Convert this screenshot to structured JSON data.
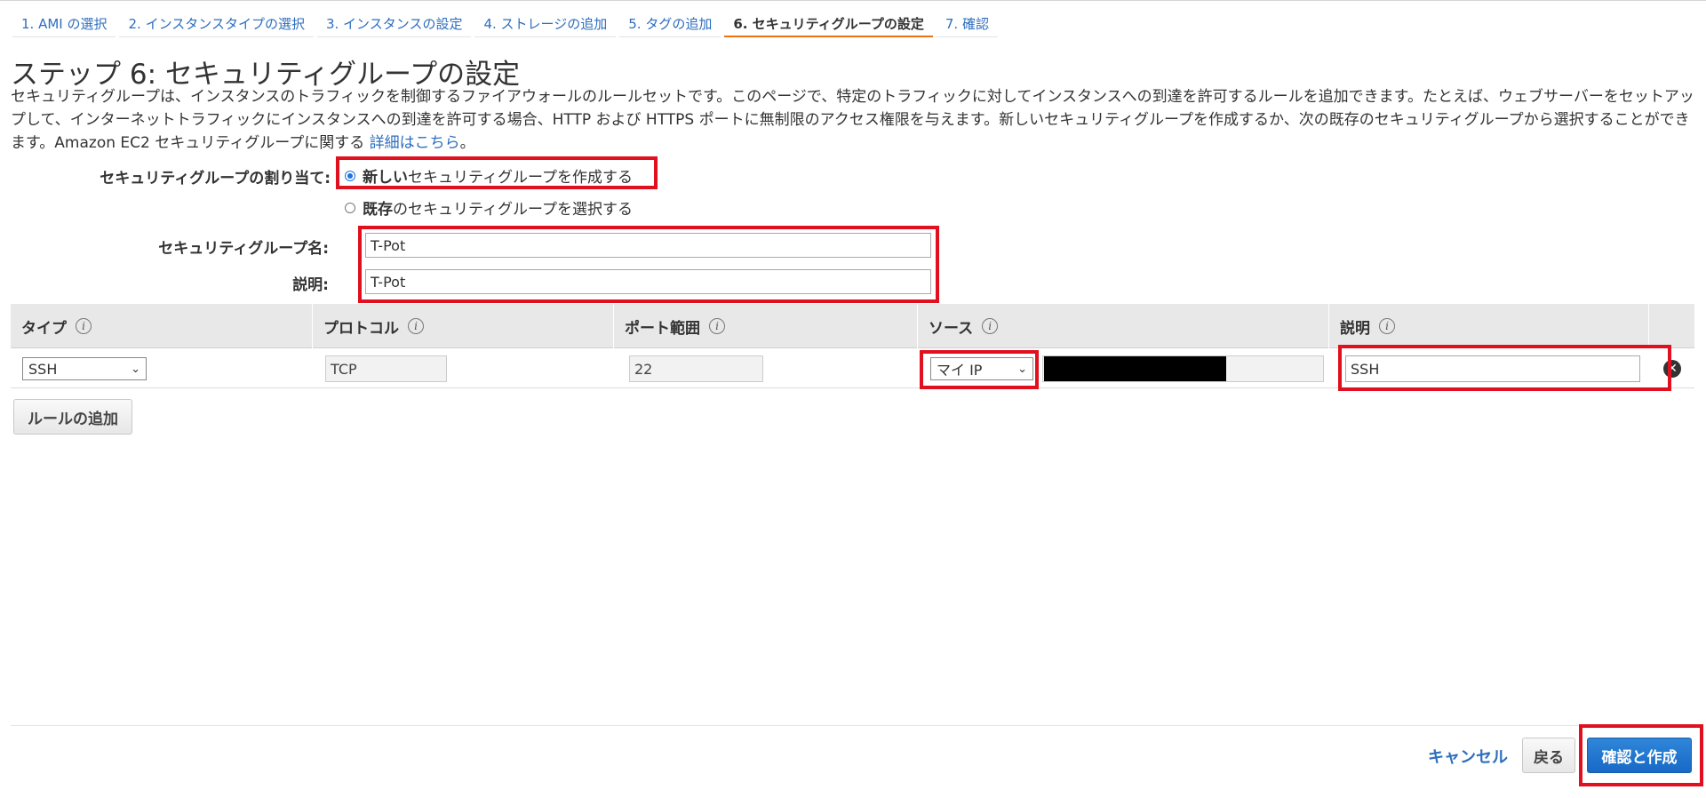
{
  "steps": [
    {
      "label": "1. AMI の選択"
    },
    {
      "label": "2. インスタンスタイプの選択"
    },
    {
      "label": "3. インスタンスの設定"
    },
    {
      "label": "4. ストレージの追加"
    },
    {
      "label": "5. タグの追加"
    },
    {
      "label": "6. セキュリティグループの設定",
      "active": true
    },
    {
      "label": "7. 確認"
    }
  ],
  "page": {
    "title": "ステップ 6: セキュリティグループの設定",
    "description": "セキュリティグループは、インスタンスのトラフィックを制御するファイアウォールのルールセットです。このページで、特定のトラフィックに対してインスタンスへの到達を許可するルールを追加できます。たとえば、ウェブサーバーをセットアップして、インターネットトラフィックにインスタンスへの到達を許可する場合、HTTP および HTTPS ポートに無制限のアクセス権限を与えます。新しいセキュリティグループを作成するか、次の既存のセキュリティグループから選択することができます。Amazon EC2 セキュリティグループに関する ",
    "learn_more": "詳細はこちら",
    "desc_end": "。"
  },
  "assign": {
    "label": "セキュリティグループの割り当て:",
    "option_new_bold": "新しい",
    "option_new_rest": "セキュリティグループを作成する",
    "option_existing_bold": "既存",
    "option_existing_rest": "のセキュリティグループを選択する",
    "selected": "new"
  },
  "group_name": {
    "label": "セキュリティグループ名:",
    "value": "T-Pot"
  },
  "group_desc": {
    "label": "説明:",
    "value": "T-Pot"
  },
  "table": {
    "headers": [
      "タイプ",
      "プロトコル",
      "ポート範囲",
      "ソース",
      "説明"
    ],
    "rows": [
      {
        "type": "SSH",
        "protocol": "TCP",
        "port": "22",
        "source": "マイ IP",
        "description": "SSH"
      }
    ]
  },
  "add_rule": "ルールの追加",
  "footer": {
    "cancel": "キャンセル",
    "back": "戻る",
    "review": "確認と作成"
  },
  "colors": {
    "link": "#2d6ebf",
    "highlight": "#e0101e",
    "active_tab": "#ec7211",
    "primary": "#1769c6"
  }
}
